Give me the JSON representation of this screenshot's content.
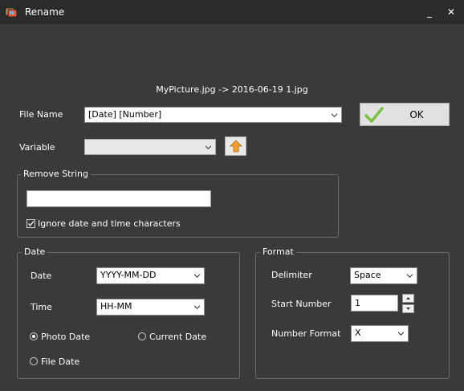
{
  "window": {
    "title": "Rename",
    "minimize": "_",
    "close": "✕"
  },
  "preview": "MyPicture.jpg -> 2016-06-19 1.jpg",
  "file_name": {
    "label": "File Name",
    "value": "[Date] [Number]"
  },
  "ok_button": {
    "label": "OK"
  },
  "variable": {
    "label": "Variable",
    "value": ""
  },
  "remove_string": {
    "title": "Remove String",
    "input_value": "",
    "ignore_checkbox": {
      "label": "Ignore date and time characters",
      "checked": true
    }
  },
  "date_group": {
    "title": "Date",
    "date_label": "Date",
    "date_value": "YYYY-MM-DD",
    "time_label": "Time",
    "time_value": "HH-MM",
    "radio_photo": "Photo Date",
    "radio_current": "Current Date",
    "radio_file": "File Date",
    "selected": "Photo Date"
  },
  "format_group": {
    "title": "Format",
    "delimiter_label": "Delimiter",
    "delimiter_value": "Space",
    "start_label": "Start Number",
    "start_value": "1",
    "number_format_label": "Number Format",
    "number_format_value": "X"
  },
  "colors": {
    "background": "#3a3a3a",
    "titlebar": "#2b2b2b",
    "ok_check": "#7cc242",
    "up_arrow": "#f0a030"
  }
}
